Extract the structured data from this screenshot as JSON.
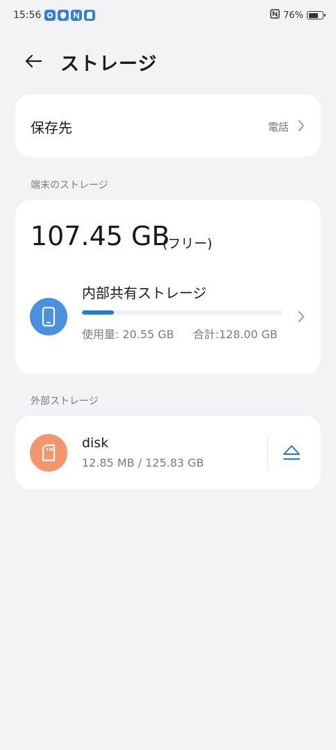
{
  "status_bar": {
    "time": "15:56",
    "battery_percent": "76%",
    "battery_level": 0.76,
    "notification_icons": [
      "settings-app-icon",
      "security-app-icon",
      "nfc-app-icon",
      "sd-card-app-icon"
    ],
    "right_icons": [
      "nfc-icon",
      "battery-icon"
    ]
  },
  "header": {
    "back_icon": "arrow-left-icon",
    "title": "ストレージ"
  },
  "save_location": {
    "label": "保存先",
    "value": "電話"
  },
  "device_section": {
    "heading": "端末のストレージ",
    "free_space": "107.45 GB",
    "free_suffix": "(フリー)",
    "internal": {
      "name": "内部共有ストレージ",
      "used_label": "使用量: 20.55 GB",
      "total_label": "合計:128.00 GB",
      "used_fraction": 0.16,
      "icon": "phone-icon",
      "icon_color": "#4a90e2",
      "bar_color": "#1e78e6"
    }
  },
  "external_section": {
    "heading": "外部ストレージ",
    "disk": {
      "name": "disk",
      "size_label": "12.85 MB / 125.83 GB",
      "icon": "sd-card-icon",
      "icon_color": "#f5956b",
      "eject_icon": "eject-icon",
      "eject_color": "#1e78e6"
    }
  }
}
